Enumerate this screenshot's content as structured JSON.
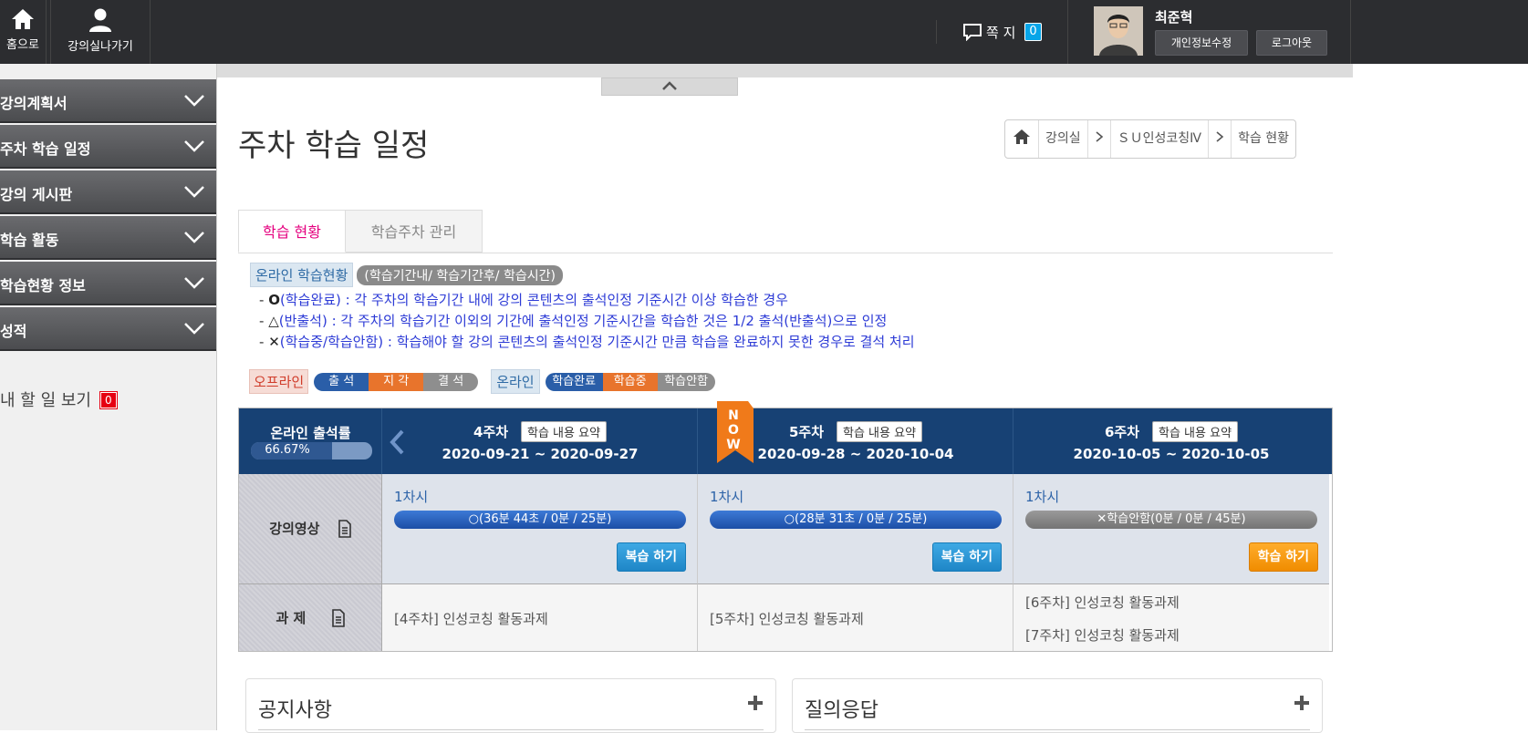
{
  "topbar": {
    "home_label": "홈으로",
    "exit_label": "강의실나가기",
    "msg_label": "쪽 지",
    "msg_count": "0",
    "user_name": "최준혁",
    "edit_profile": "개인정보수정",
    "logout": "로그아웃"
  },
  "sidebar": {
    "items": [
      {
        "label": "강의계획서"
      },
      {
        "label": "주차 학습 일정"
      },
      {
        "label": "강의 게시판"
      },
      {
        "label": "학습 활동"
      },
      {
        "label": "학습현황 정보"
      },
      {
        "label": "성적"
      }
    ],
    "todo_label": "내 할 일 보기",
    "todo_count": "0"
  },
  "page": {
    "title": "주차 학습 일정",
    "breadcrumb": [
      "강의실",
      "ＳＵ인성코칭Ⅳ",
      "학습 현황"
    ]
  },
  "tabs": {
    "active": "학습 현황",
    "other": "학습주차 관리"
  },
  "legend": {
    "online_status": "온라인 학습현황",
    "online_status_desc": "(학습기간내/ 학습기간후/ 학습시간)",
    "rules": [
      {
        "symbol": "O",
        "text": "(학습완료) : 각 주차의 학습기간 내에 강의 콘텐츠의 출석인정 기준시간 이상 학습한 경우"
      },
      {
        "symbol": "△",
        "text": "(반출석) : 각 주차의 학습기간 이외의 기간에 출석인정 기준시간을 학습한 것은 1/2 출석(반출석)으로 인정"
      },
      {
        "symbol": "✕",
        "text": "(학습중/학습안함) : 학습해야 할 강의 콘텐츠의 출석인정 기준시간 만큼 학습을 완료하지 못한 경우로 결석 처리"
      }
    ],
    "offline_label": "오프라인",
    "offline_items": [
      "출 석",
      "지 각",
      "결 석"
    ],
    "online_label": "온라인",
    "online_items": [
      "학습완료",
      "학습중",
      "학습안함"
    ],
    "colors": {
      "attend": "#2a5ea8",
      "late": "#e8742c",
      "absent": "#8e8e8e"
    }
  },
  "table": {
    "attendance_title": "온라인 출석률",
    "attendance_rate_text": "66.67%",
    "attendance_rate": 0.6667,
    "now_label": "NOW",
    "summary_label": "학습 내용 요약",
    "video_label": "강의영상",
    "task_label": "과 제",
    "weeks": [
      {
        "name": "4주차",
        "dates": "2020-09-21 ~ 2020-09-27",
        "session": "1차시",
        "progress": "(36분 44초 / 0분 / 25분)",
        "status": "done",
        "status_symbol": "○",
        "action": "복습 하기",
        "tasks": [
          "[4주차] 인성코칭 활동과제"
        ]
      },
      {
        "name": "5주차",
        "dates": "2020-09-28 ~ 2020-10-04",
        "session": "1차시",
        "progress": "(28분 31초 / 0분 / 25분)",
        "status": "done",
        "status_symbol": "○",
        "action": "복습 하기",
        "tasks": [
          "[5주차] 인성코칭 활동과제"
        ]
      },
      {
        "name": "6주차",
        "dates": "2020-10-05 ~ 2020-10-05",
        "session": "1차시",
        "progress": "학습안함(0분 / 0분 / 45분)",
        "status": "not",
        "status_symbol": "✕",
        "action": "학습 하기",
        "tasks": [
          "[6주차] 인성코칭 활동과제",
          "[7주차] 인성코칭 활동과제"
        ]
      }
    ]
  },
  "panels": {
    "notice": "공지사항",
    "qna": "질의응답"
  }
}
